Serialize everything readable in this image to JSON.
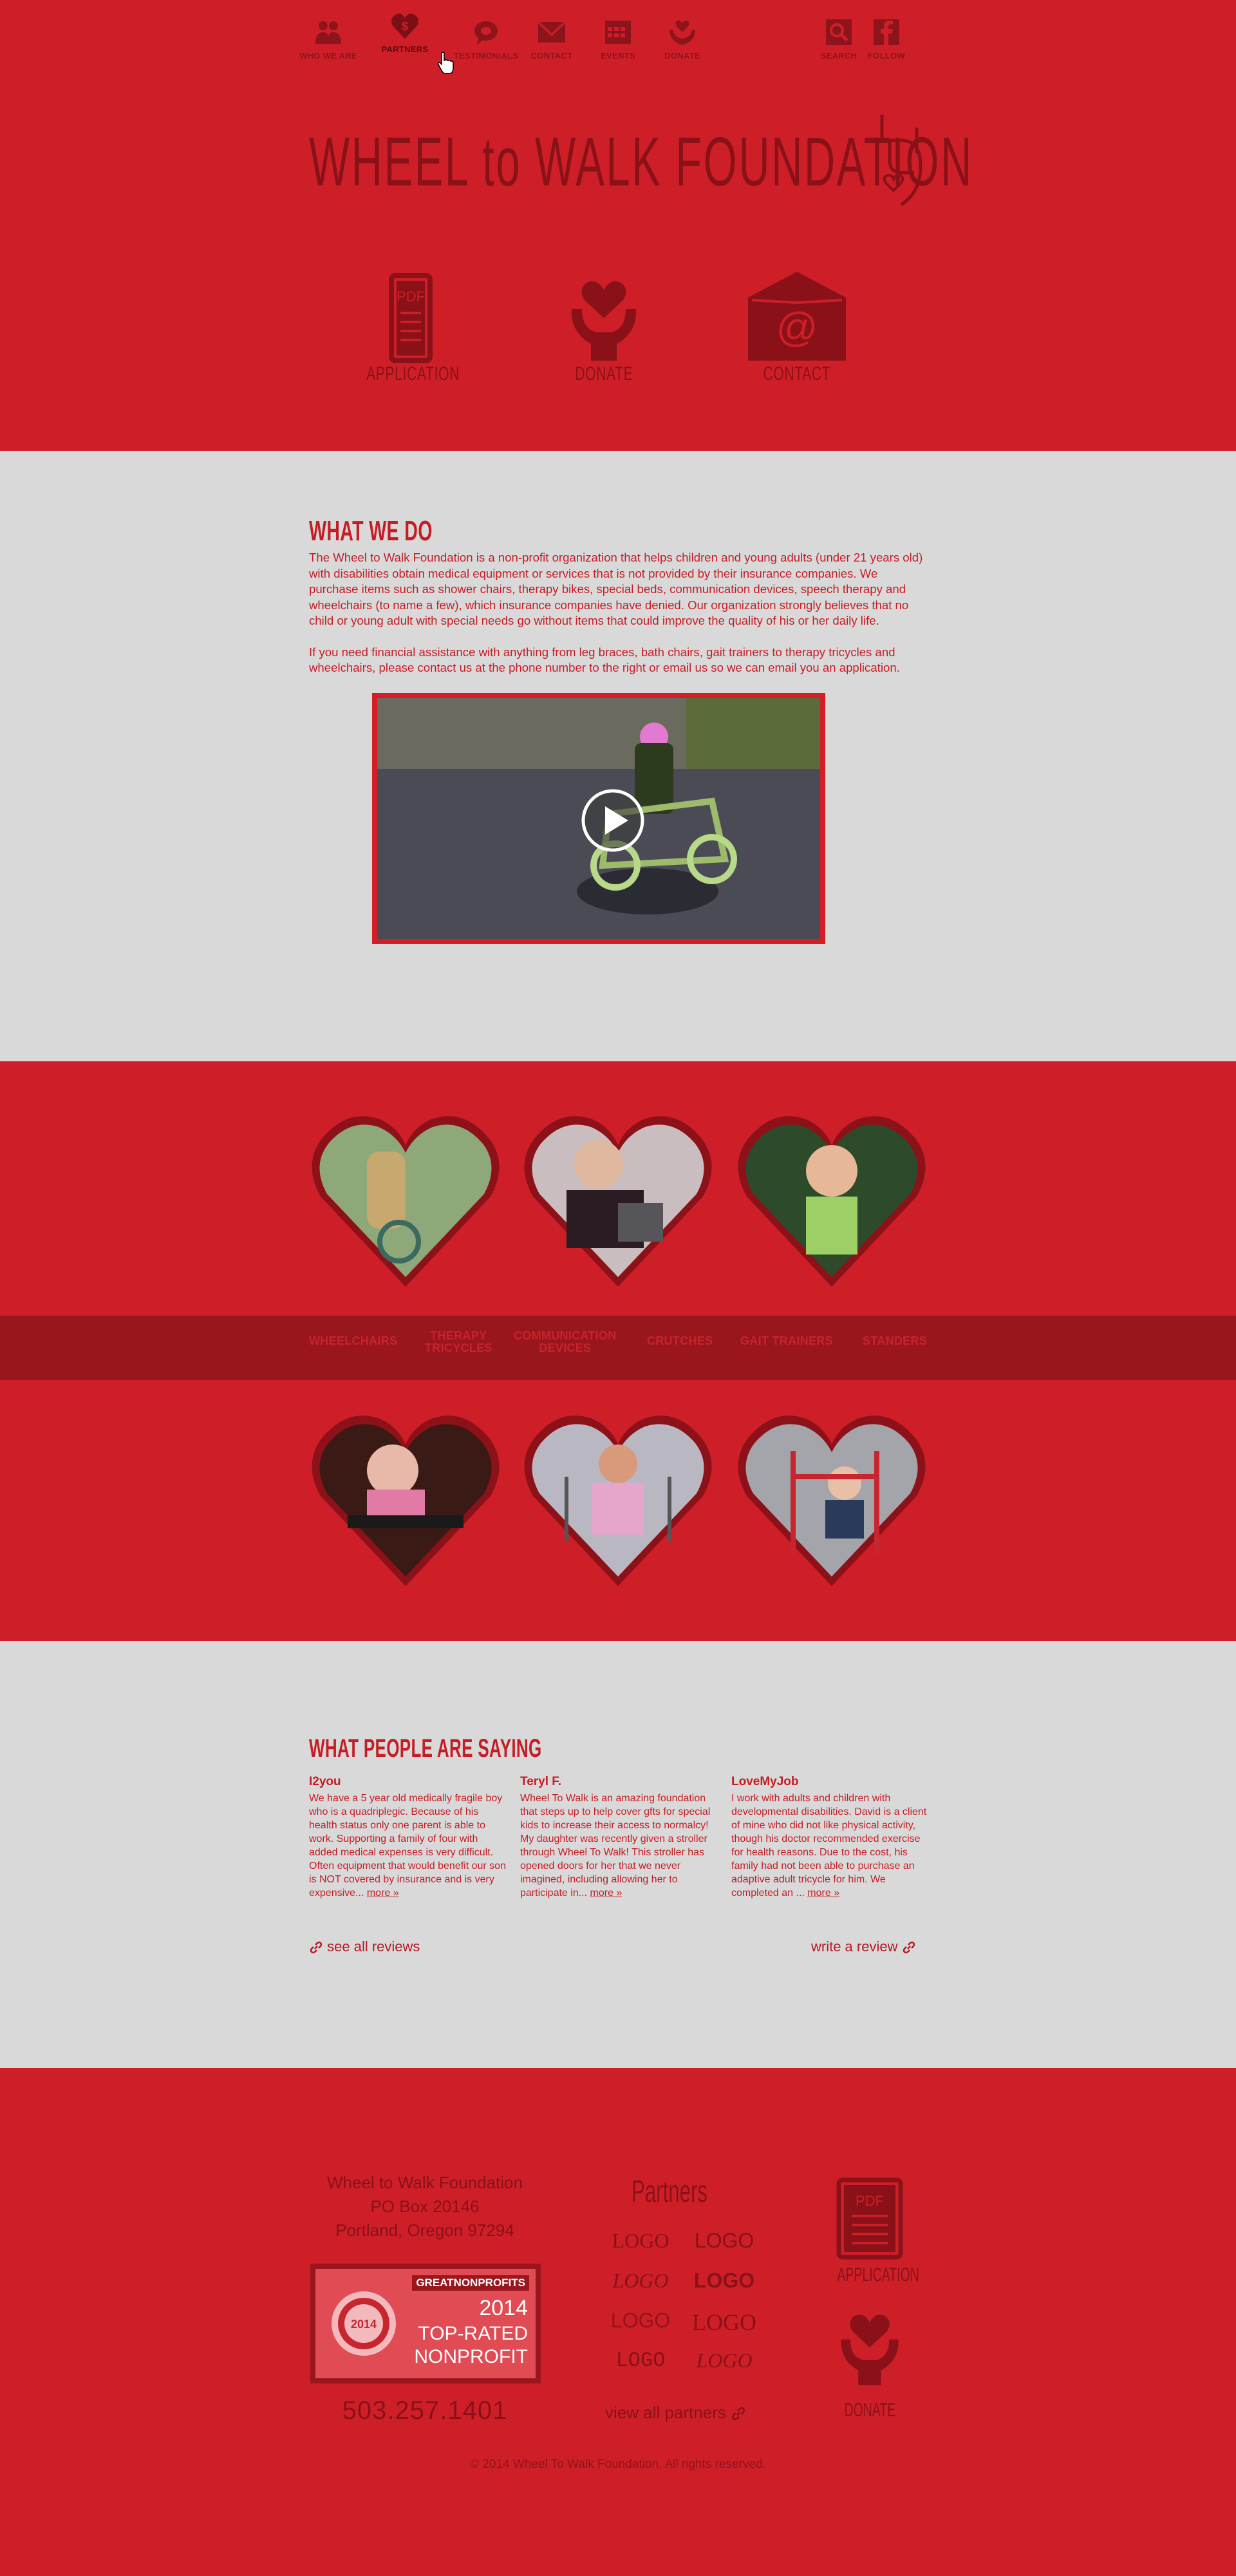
{
  "colors": {
    "primary_red": "#ce1f28",
    "dark_red": "#8a1118",
    "band_red": "#99161d",
    "gray_bg": "#d9d9d9"
  },
  "nav": {
    "items": [
      {
        "label": "WHO WE ARE",
        "icon": "people-icon"
      },
      {
        "label": "PARTNERS",
        "icon": "heart-dollar-icon",
        "active": true
      },
      {
        "label": "TESTIMONIALS",
        "icon": "speech-bubble-icon"
      },
      {
        "label": "CONTACT",
        "icon": "envelope-icon"
      },
      {
        "label": "EVENTS",
        "icon": "calendar-icon"
      },
      {
        "label": "DONATE",
        "icon": "hands-heart-icon"
      }
    ],
    "right": [
      {
        "label": "SEARCH",
        "icon": "search-icon"
      },
      {
        "label": "FOLLOW",
        "icon": "facebook-icon"
      }
    ]
  },
  "logo": {
    "text": "WHEEL to WALK FOUNDATION"
  },
  "quick_links": [
    {
      "label": "APPLICATION",
      "icon": "pdf-document-icon"
    },
    {
      "label": "DONATE",
      "icon": "hands-heart-icon"
    },
    {
      "label": "CONTACT",
      "icon": "email-envelope-icon"
    }
  ],
  "what_we_do": {
    "title": "WHAT WE DO",
    "p1": "The Wheel to Walk Foundation is a non-profit organization that helps children and young adults (under 21 years old) with disabilities obtain medical equipment or services that is not provided by their insurance companies. We purchase items such as shower chairs, therapy bikes, special beds, communication devices, speech therapy and wheelchairs (to name a few), which insurance companies have denied. Our organization strongly believes that no child or young adult with special needs go without items that could improve the quality of his or her daily life.",
    "p2": "If you need financial assistance with anything from leg braces, bath chairs, gait trainers to therapy tricycles and wheelchairs, please contact us at the phone number to the right or email us so we can email you an application."
  },
  "categories": {
    "items": [
      "WHEELCHAIRS",
      "THERAPY\nTRICYCLES",
      "COMMUNICATION\nDEVICES",
      "CRUTCHES",
      "GAIT TRAINERS",
      "STANDERS"
    ]
  },
  "testimonials": {
    "title": "WHAT PEOPLE ARE SAYING",
    "items": [
      {
        "name": "I2you",
        "text": "We have a 5 year old medically fragile boy who is a quadriplegic. Because of his health status only one parent is able to work. Supporting a family of four with added medical expenses is very difficult. Often equipment that would benefit our son is NOT covered by insurance and is very expensive...",
        "more": "more »"
      },
      {
        "name": "Teryl F.",
        "text": "Wheel To Walk is an amazing foundation that steps up to help cover gfts for special kids to increase their access to normalcy! My daughter was recently given a stroller through Wheel To Walk! This stroller has opened doors for her that we never imagined, including allowing her to participate in...",
        "more": "more »"
      },
      {
        "name": "LoveMyJob",
        "text": "I work with adults and children with developmental disabilities. David is a client of mine who did not like physical activity, though his doctor recommended exercise for health reasons. Due to the cost, his family had not been able to purchase an adaptive adult tricycle for him. We completed an ...",
        "more": "more »"
      }
    ],
    "see_all": "see all reviews",
    "write": "write a review"
  },
  "footer": {
    "address": [
      "Wheel to Walk Foundation",
      "PO Box 20146",
      "Portland, Oregon 97294"
    ],
    "badge": {
      "top": "GREATNONPROFITS",
      "year": "2014",
      "line1": "TOP-RATED",
      "line2": "NONPROFIT",
      "seal_text": "2014"
    },
    "phone": "503.257.1401",
    "partners_title": "Partners",
    "partner_logos": [
      "LOGO",
      "LOGO",
      "LOGO",
      "LOGO",
      "LOGO",
      "LOGO",
      "LOGO",
      "LOGO"
    ],
    "view_partners": "view all partners",
    "quick": [
      {
        "label": "APPLICATION",
        "icon": "pdf-document-icon"
      },
      {
        "label": "DONATE",
        "icon": "hands-heart-icon"
      }
    ],
    "copyright": "© 2014 Wheel To Walk Foundation. All rights reserved."
  }
}
